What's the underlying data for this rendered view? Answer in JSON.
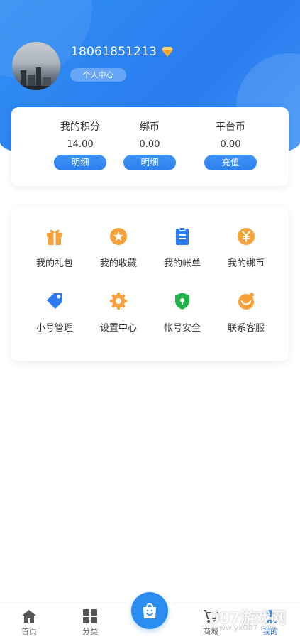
{
  "header": {
    "phone": "18061851213",
    "center_label": "个人中心"
  },
  "points": [
    {
      "label": "我的积分",
      "value": "14.00",
      "button": "明细"
    },
    {
      "label": "绑币",
      "value": "0.00",
      "button": "明细"
    },
    {
      "label": "平台币",
      "value": "0.00",
      "button": "充值"
    }
  ],
  "functions": [
    {
      "label": "我的礼包",
      "icon": "gift-icon"
    },
    {
      "label": "我的收藏",
      "icon": "star-icon"
    },
    {
      "label": "我的帐单",
      "icon": "clipboard-icon"
    },
    {
      "label": "我的绑币",
      "icon": "yen-icon"
    },
    {
      "label": "小号管理",
      "icon": "tag-icon"
    },
    {
      "label": "设置中心",
      "icon": "gear-icon"
    },
    {
      "label": "帐号安全",
      "icon": "shield-icon"
    },
    {
      "label": "联系客服",
      "icon": "smile-icon"
    }
  ],
  "tabbar": {
    "home": "首页",
    "category": "分类",
    "shop": "商城",
    "mine": "我的"
  },
  "watermark": {
    "brand": "007游戏网",
    "url": "www.yx007.com"
  },
  "colors": {
    "primary": "#2b7cf0",
    "icon_blue": "#2b7cf0",
    "icon_orange": "#f6a03a",
    "icon_green": "#22b24c"
  }
}
